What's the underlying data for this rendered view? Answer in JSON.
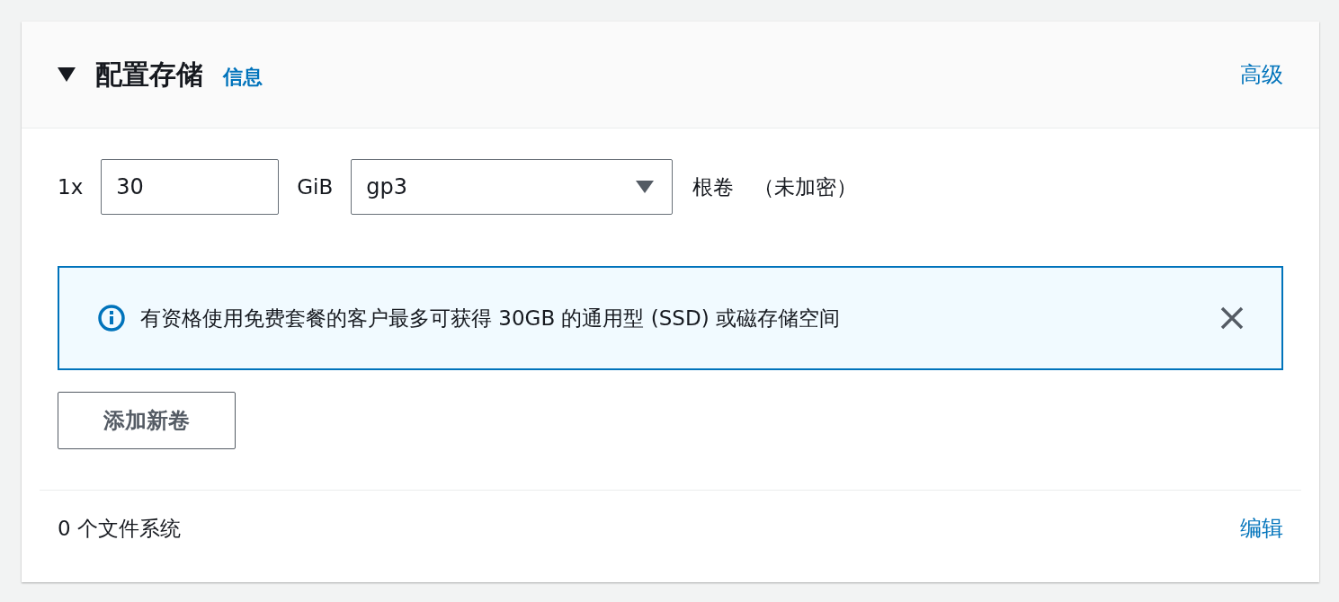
{
  "panel": {
    "title": "配置存储",
    "info_link": "信息",
    "advanced_link": "高级",
    "expanded": true
  },
  "volume": {
    "count": "1x",
    "size": "30",
    "unit": "GiB",
    "type": "gp3",
    "label": "根卷",
    "encryption": "（未加密）"
  },
  "alert": {
    "message": "有资格使用免费套餐的客户最多可获得 30GB 的通用型 (SSD) 或磁存储空间"
  },
  "add_button": "添加新卷",
  "footer": {
    "summary": "0 个文件系统",
    "edit_link": "编辑"
  }
}
